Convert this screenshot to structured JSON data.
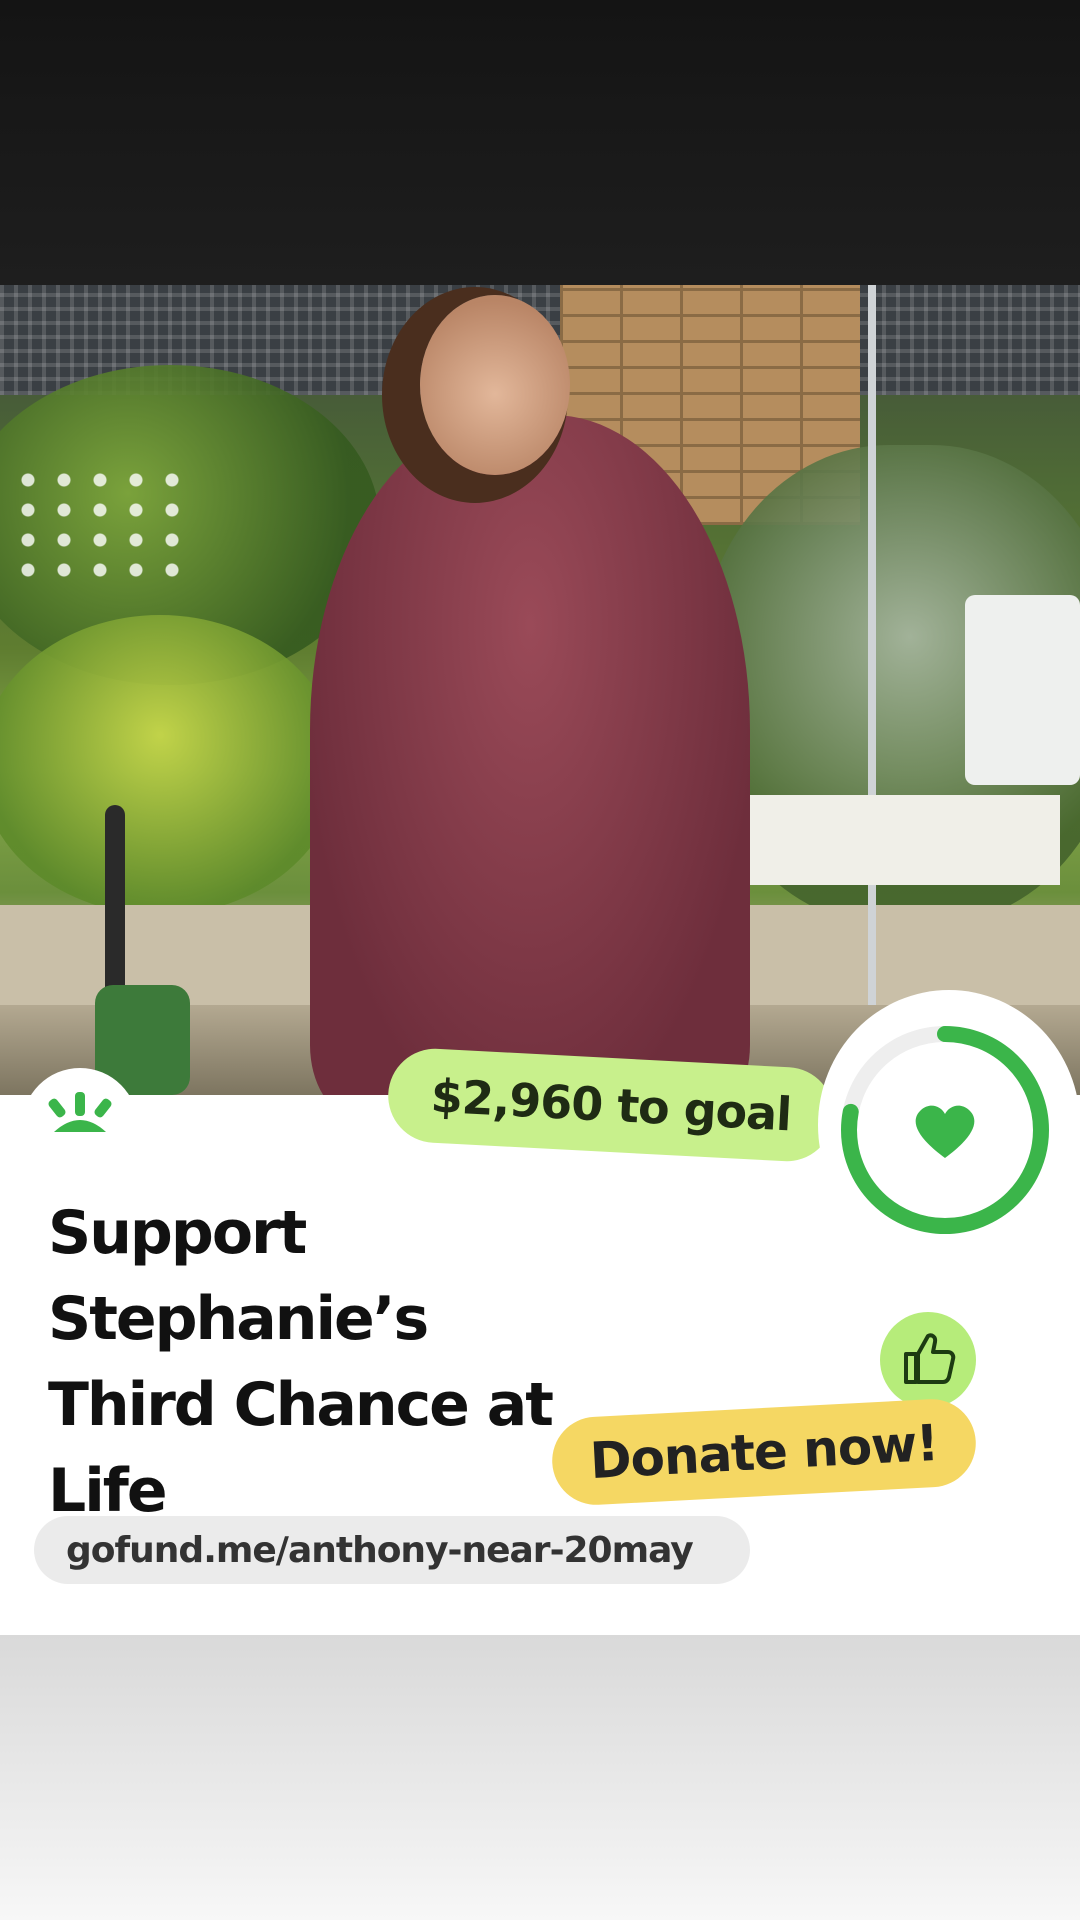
{
  "campaign": {
    "goal_text": "$2,960 to goal",
    "title_line1": "Support Stephanie’s",
    "title_line2": "Third Chance at Life",
    "cta_label": "Donate now!",
    "url": "gofund.me/anthony-near-20may",
    "progress_fraction": 0.78
  },
  "colors": {
    "brand_green": "#3bb54a",
    "goal_pill": "#c8f08c",
    "cta_yellow": "#f5d763",
    "url_pill": "#ebebeb",
    "thumb_circle": "#b6ec7a"
  },
  "icons": {
    "logo": "gofundme-logo-icon",
    "heart": "heart-icon",
    "thumbs_up": "thumbs-up-icon"
  }
}
